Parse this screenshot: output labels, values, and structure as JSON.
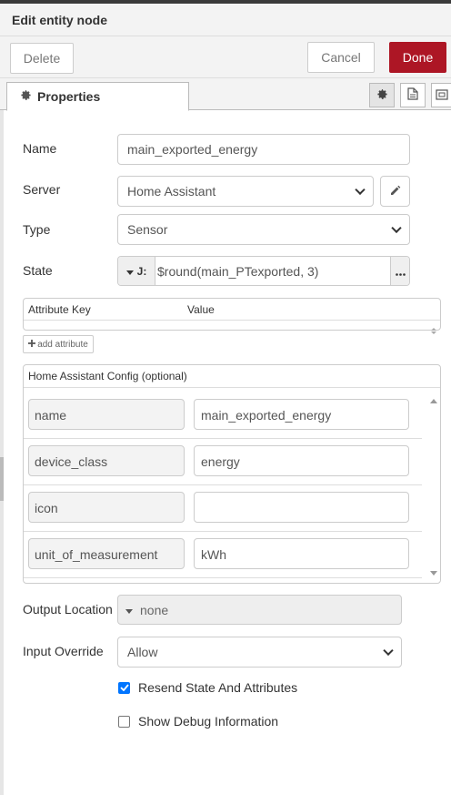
{
  "dialog": {
    "title": "Edit entity node"
  },
  "toolbar": {
    "delete_label": "Delete",
    "cancel_label": "Cancel",
    "done_label": "Done"
  },
  "tabs": {
    "properties_label": "Properties"
  },
  "form": {
    "name": {
      "label": "Name",
      "value": "main_exported_energy"
    },
    "server": {
      "label": "Server",
      "value": "Home Assistant"
    },
    "type": {
      "label": "Type",
      "value": "Sensor"
    },
    "state": {
      "label": "State",
      "type_glyph": "J:",
      "value": "$round(main_PTexported, 3)"
    },
    "attributes": {
      "key_header": "Attribute Key",
      "value_header": "Value",
      "add_label": "add attribute"
    },
    "ha_config": {
      "header": "Home Assistant Config (optional)",
      "rows": [
        {
          "key": "name",
          "value": "main_exported_energy"
        },
        {
          "key": "device_class",
          "value": "energy"
        },
        {
          "key": "icon",
          "value": ""
        },
        {
          "key": "unit_of_measurement",
          "value": "kWh"
        }
      ]
    },
    "output_location": {
      "label": "Output Location",
      "value": "none"
    },
    "input_override": {
      "label": "Input Override",
      "value": "Allow"
    },
    "resend_state": {
      "label": "Resend State And Attributes",
      "checked": true
    },
    "show_debug": {
      "label": "Show Debug Information",
      "checked": false
    }
  },
  "colors": {
    "done_button": "#ad1625",
    "checkbox_checked": "#0075ff"
  }
}
